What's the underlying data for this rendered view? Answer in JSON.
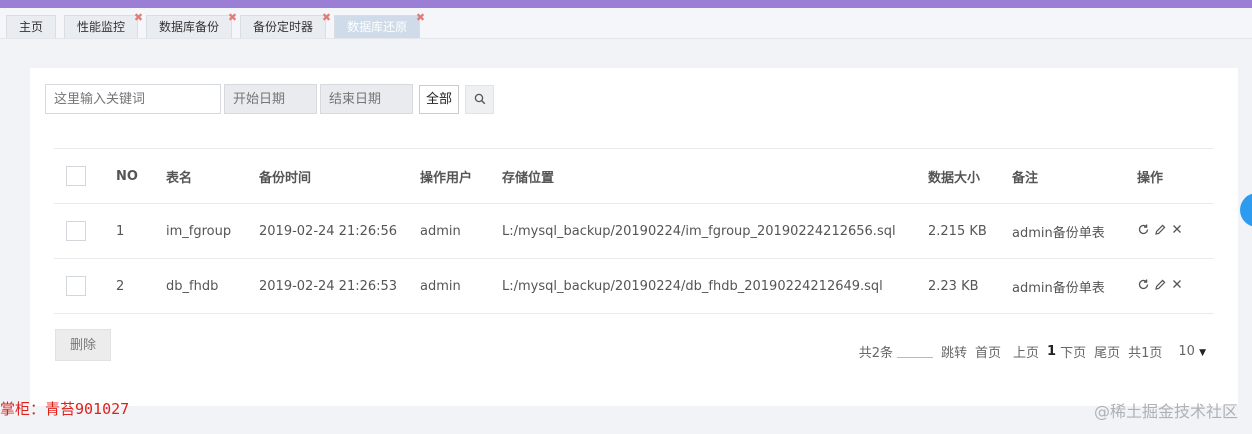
{
  "tabs": [
    {
      "label": "主页",
      "closable": false,
      "active": false
    },
    {
      "label": "性能监控",
      "closable": true,
      "active": false
    },
    {
      "label": "数据库备份",
      "closable": true,
      "active": false
    },
    {
      "label": "备份定时器",
      "closable": true,
      "active": false
    },
    {
      "label": "数据库还原",
      "closable": true,
      "active": true
    }
  ],
  "filters": {
    "keyword_placeholder": "这里输入关键词",
    "start_placeholder": "开始日期",
    "end_placeholder": "结束日期",
    "scope_label": "全部"
  },
  "table": {
    "headers": [
      "NO",
      "表名",
      "备份时间",
      "操作用户",
      "存储位置",
      "数据大小",
      "备注",
      "操作"
    ],
    "rows": [
      {
        "no": "1",
        "table": "im_fgroup",
        "time": "2019-02-24 21:26:56",
        "user": "admin",
        "path": "L:/mysql_backup/20190224/im_fgroup_20190224212656.sql",
        "size": "2.215 KB",
        "note": "admin备份单表"
      },
      {
        "no": "2",
        "table": "db_fhdb",
        "time": "2019-02-24 21:26:53",
        "user": "admin",
        "path": "L:/mysql_backup/20190224/db_fhdb_20190224212649.sql",
        "size": "2.23 KB",
        "note": "admin备份单表"
      }
    ]
  },
  "delete_label": "删除",
  "pager": {
    "total": "共2条",
    "jump": "跳转",
    "first": "首页",
    "prev": "上页",
    "current": "1",
    "next": "下页",
    "last": "尾页",
    "pages": "共1页",
    "page_size": "10",
    "page_size_arrow": "▼"
  },
  "watermark_left": "掌柜：青苔901027",
  "watermark_right": "@稀土掘金技术社区",
  "colors": {
    "topbar": "#9b7fd4",
    "tab_close": "#e27b7b",
    "accent_blue": "#2d9cf0"
  }
}
